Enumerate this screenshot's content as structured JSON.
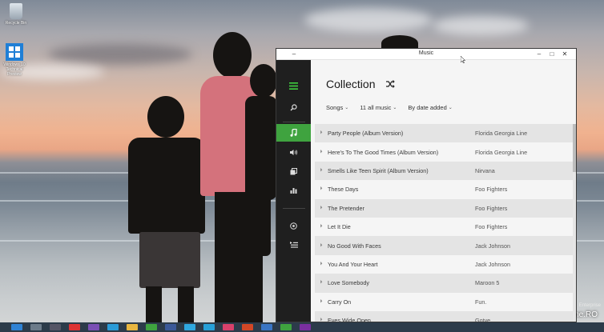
{
  "desktop": {
    "icons": [
      {
        "label": "Recycle Bin",
        "icon": "recycle-bin-icon"
      },
      {
        "label": "Windows 10 Technical Preview",
        "icon": "windows-icon"
      }
    ],
    "watermark": "mobzine.RO",
    "edition": "Enterprise"
  },
  "window": {
    "title": "Music",
    "controls": {
      "minimize": "–",
      "maximize": "□",
      "close": "✕"
    }
  },
  "rail": {
    "items": [
      {
        "name": "menu",
        "icon": "hamburger-icon"
      },
      {
        "name": "search",
        "icon": "search-icon"
      },
      {
        "name": "collection",
        "icon": "music-note-icon",
        "active": true
      },
      {
        "name": "radio",
        "icon": "radio-icon"
      },
      {
        "name": "albums",
        "icon": "albums-icon"
      },
      {
        "name": "charts",
        "icon": "chart-icon"
      },
      {
        "name": "add",
        "icon": "add-circle-icon"
      },
      {
        "name": "queue",
        "icon": "now-playing-list-icon"
      }
    ]
  },
  "collection": {
    "heading": "Collection",
    "filters": {
      "view": "Songs",
      "scope": "11 all music",
      "sort": "By date added"
    },
    "songs": [
      {
        "title": "Party People (Album Version)",
        "artist": "Florida Georgia Line"
      },
      {
        "title": "Here's To The Good Times (Album Version)",
        "artist": "Florida Georgia Line"
      },
      {
        "title": "Smells Like Teen Spirit (Album Version)",
        "artist": "Nirvana"
      },
      {
        "title": "These Days",
        "artist": "Foo Fighters"
      },
      {
        "title": "The Pretender",
        "artist": "Foo Fighters"
      },
      {
        "title": "Let It Die",
        "artist": "Foo Fighters"
      },
      {
        "title": "No Good With Faces",
        "artist": "Jack Johnson"
      },
      {
        "title": "You And Your Heart",
        "artist": "Jack Johnson"
      },
      {
        "title": "Love Somebody",
        "artist": "Maroon 5"
      },
      {
        "title": "Carry On",
        "artist": "Fun."
      },
      {
        "title": "Eyes Wide Open",
        "artist": "Gotye"
      }
    ]
  },
  "colors": {
    "accent": "#3fa33f",
    "rail": "#1f1f1f",
    "row_alt": "#e4e4e4"
  }
}
